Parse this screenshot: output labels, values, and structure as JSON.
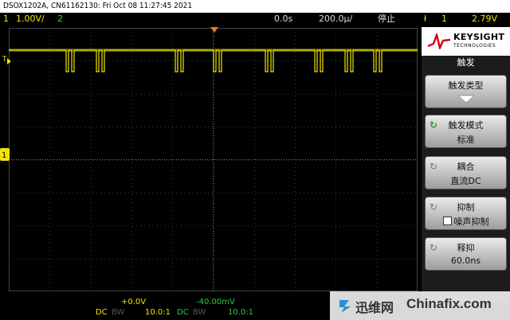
{
  "header": {
    "title": "DSOX1202A, CN61162130: Fri Oct 08 11:27:45 2021"
  },
  "status": {
    "ch1_num": "1",
    "ch1_scale": "1.00V/",
    "ch2_num": "2",
    "delay": "0.0s",
    "timebase": "200.0µ/",
    "run_state": "停止",
    "trigger_icon": "ł",
    "trigger_src": "1",
    "trigger_level": "2.79V"
  },
  "brand": {
    "name": "KEYSIGHT",
    "sub": "TECHNOLOGIES"
  },
  "menu": {
    "title": "触发",
    "buttons": [
      {
        "line1": "触发类型",
        "line2": ""
      },
      {
        "line1": "触发模式",
        "line2": "标准"
      },
      {
        "line1": "耦合",
        "line2": "直流DC"
      },
      {
        "line1": "抑制",
        "line2": "噪声抑制"
      },
      {
        "line1": "释抑",
        "line2": "60.0ns"
      }
    ]
  },
  "markers": {
    "trigger_level": "T"
  },
  "channels": [
    {
      "offset": "+0.0V",
      "coupling": "DC",
      "bw": "BW",
      "probe": "10.0:1"
    },
    {
      "offset": "-40.00mV",
      "coupling": "DC",
      "bw": "BW",
      "probe": "10.0:1"
    }
  ],
  "watermark": {
    "left": "迅维网",
    "right": "Chinafix.com"
  },
  "colors": {
    "ch1": "#f2e600",
    "ch2": "#2ecc40",
    "accent": "#e87a1e"
  },
  "icons": [
    "keysight-logo-icon",
    "down-arrow-icon",
    "trigger-mode-icon",
    "checkbox-icon",
    "trigger-edge-icon"
  ]
}
